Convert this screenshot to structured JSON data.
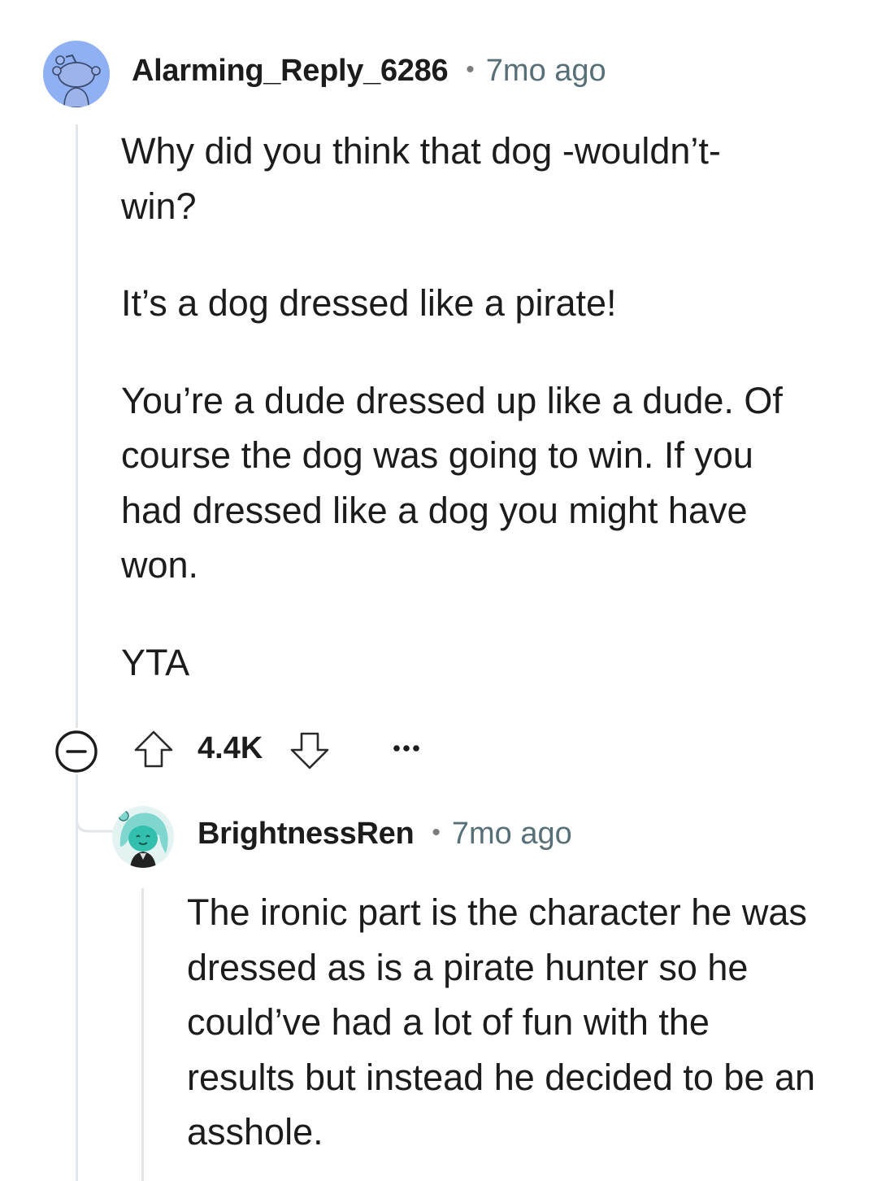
{
  "comments": [
    {
      "username": "Alarming_Reply_6286",
      "separator": "•",
      "time": "7mo ago",
      "paragraphs": [
        "Why did you think that dog -wouldn’t- win?",
        "It’s a dog dressed like a pirate!",
        "You’re a dude dressed up like a dude. Of course the dog was going to win. If you had dressed like a dog you might have won.",
        "YTA"
      ],
      "score": "4.4K",
      "more_label": "•••",
      "avatar_color": "#8fb0f2"
    },
    {
      "username": "BrightnessRen",
      "separator": "•",
      "time": "7mo ago",
      "paragraphs": [
        "The ironic part is the character he was dressed as is a pirate hunter so he could’ve had a lot of fun with the results but instead he decided to be an asshole."
      ],
      "avatar_color": "#dcf0ee"
    }
  ],
  "icons": {
    "collapse": "collapse-minus-icon",
    "upvote": "upvote-arrow-icon",
    "downvote": "downvote-arrow-icon",
    "more": "more-options-icon"
  }
}
